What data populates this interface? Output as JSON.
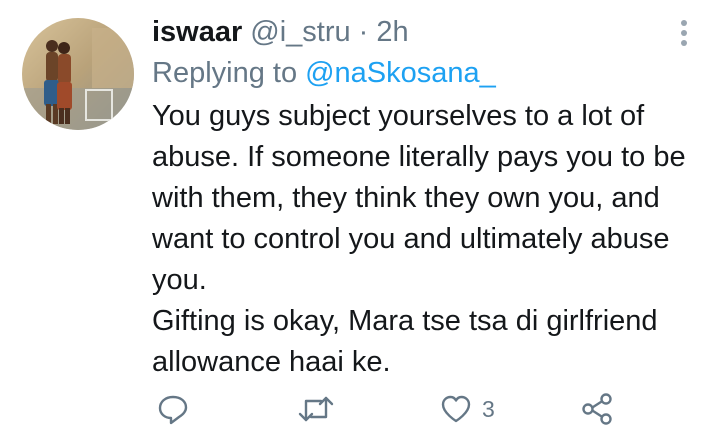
{
  "tweet": {
    "display_name": "iswaar",
    "handle": "@i_stru",
    "separator": "·",
    "time": "2h",
    "replying_label": "Replying to",
    "replying_to": "@naSkosana_",
    "body_lines": [
      "You guys subject yourselves to a lot of abuse. If someone literally pays you to be with them, they think they own you, and want to control you and ultimately abuse you.",
      "Gifting is okay, Mara tse tsa di girlfriend allowance haai ke."
    ],
    "like_count": "3"
  },
  "icons": {
    "more": "more-vertical-icon",
    "reply": "reply-icon",
    "retweet": "retweet-icon",
    "like": "like-icon",
    "share": "share-icon"
  },
  "colors": {
    "primary_text": "#14171a",
    "secondary_text": "#657786",
    "link": "#1da1f2"
  }
}
